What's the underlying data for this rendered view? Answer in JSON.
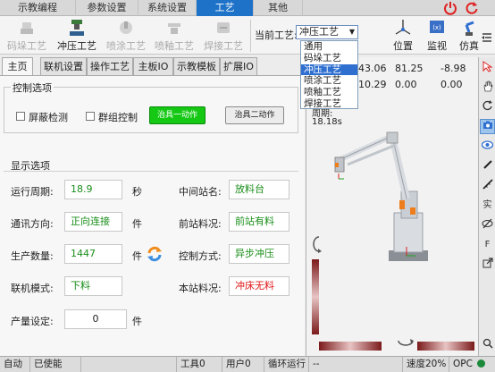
{
  "top_tabs": [
    "示教编程",
    "参数设置",
    "系统设置",
    "工艺",
    "其他"
  ],
  "active_top_tab": "工艺",
  "top_icons": [
    "power-icon",
    "reset-icon"
  ],
  "toolbar": {
    "tools": [
      {
        "label": "码垛工艺",
        "icon": "palletizing-icon",
        "enabled": false
      },
      {
        "label": "冲压工艺",
        "icon": "stamping-icon",
        "enabled": true
      },
      {
        "label": "喷涂工艺",
        "icon": "spraying-icon",
        "enabled": false
      },
      {
        "label": "喷釉工艺",
        "icon": "glazing-icon",
        "enabled": false
      },
      {
        "label": "焊接工艺",
        "icon": "welding-icon",
        "enabled": false
      }
    ],
    "current_process_label": "当前工艺:",
    "current_process_value": "冲压工艺",
    "process_options": [
      "通用",
      "码垛工艺",
      "冲压工艺",
      "喷涂工艺",
      "喷釉工艺",
      "焊接工艺"
    ],
    "selected_option": "冲压工艺",
    "right_tools": [
      {
        "label": "位置",
        "icon": "position-icon"
      },
      {
        "label": "监视",
        "icon": "monitor-icon"
      },
      {
        "label": "仿真",
        "icon": "simulation-icon"
      }
    ]
  },
  "content_tabs": [
    "主页",
    "联机设置",
    "操作工艺",
    "主板IO",
    "示教模板",
    "扩展IO"
  ],
  "active_content_tab": "主页",
  "control": {
    "title": "控制选项",
    "shield_detect": "屏蔽检测",
    "group_control": "群组控制",
    "fixture1": "治具一动作",
    "fixture2": "治具二动作"
  },
  "display": {
    "title": "显示选项",
    "run_cycle_label": "运行周期:",
    "run_cycle_value": "18.9",
    "run_cycle_unit": "秒",
    "middle_station_label": "中间站名:",
    "middle_station_value": "放料台",
    "comm_dir_label": "通讯方向:",
    "comm_dir_value": "正向连接",
    "comm_dir_unit": "件",
    "front_material_label": "前站料况:",
    "front_material_value": "前站有料",
    "prod_count_label": "生产数量:",
    "prod_count_value": "1447",
    "prod_count_unit": "件",
    "ctrl_mode_label": "控制方式:",
    "ctrl_mode_value": "异步冲压",
    "link_mode_label": "联机模式:",
    "link_mode_value": "下料",
    "this_material_label": "本站料况:",
    "this_material_value": "冲床无料",
    "yield_set_label": "产量设定:",
    "yield_set_value": "0",
    "yield_set_unit": "件"
  },
  "right_panel": {
    "values_row1": [
      "43.06",
      "81.25",
      "-8.98"
    ],
    "values_row2": [
      "10.29",
      "0.00",
      "0.00"
    ],
    "cycle_label": "周期:",
    "cycle_time": "18.18s"
  },
  "vertical_tools": [
    "cursor-icon",
    "hand-icon",
    "rotate-icon",
    "camera-icon",
    "eye-icon",
    "pen-icon",
    "ruler-icon",
    "实",
    "eye-off-icon",
    "F",
    "export-icon",
    "zoom-icon"
  ],
  "status_bar": [
    "自动",
    "已使能",
    "",
    "工具0",
    "用户0",
    "循环运行",
    "--",
    "速度20%",
    "OPC"
  ]
}
